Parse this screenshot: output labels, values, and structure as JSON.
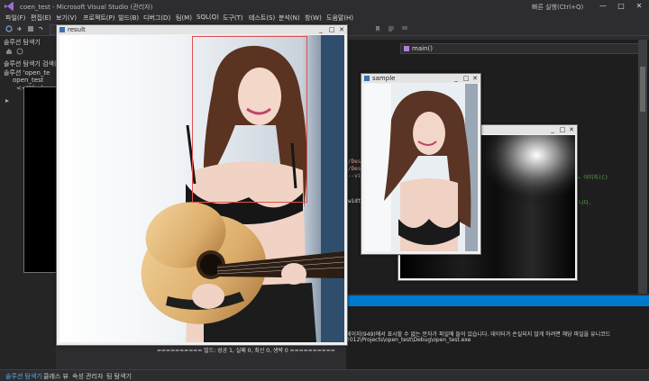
{
  "window": {
    "title": "coen_test - Microsoft Visual Studio (관리자)",
    "quick_launch": "빠른 실행(Ctrl+Q)",
    "minimize": "—",
    "maximize": "□",
    "close": "✕"
  },
  "menu": [
    "파일(F)",
    "편집(E)",
    "보기(V)",
    "프로젝트(P)",
    "빌드(B)",
    "디버그(D)",
    "팀(M)",
    "SQL(Q)",
    "도구(T)",
    "테스트(S)",
    "분석(N)",
    "창(W)",
    "도움말(H)"
  ],
  "solution_explorer": {
    "title": "솔루션 탐색기",
    "search_placeholder": "솔루션 탐색기 검색(",
    "items": [
      "솔루션 'open_te",
      "open_test",
      "<<Wind"
    ]
  },
  "editor": {
    "function_combo": "main()",
    "code_lines": [
      "/Desk",
      "/Desk",
      "--vide",
      "→ 이미지(C)",
      "width",
      "니다.",
      "니다."
    ]
  },
  "output": {
    "lines": [
      "페이지(949)에서 표시할 수 없는 문자가 파일에 들어 있습니다. 데이터가 손실되지 않게 하려면 해당 파일을 유니코드",
      "2012\\Projects\\open_test\\Debug\\open_test.exe"
    ],
    "build_summary": "========== 빌드: 성공 1, 실패 0, 최신 0, 생략 0 =========="
  },
  "status_bar": {
    "items": [
      "솔루션 탐색기",
      "클래스 뷰",
      "속성 관리자",
      "팀 탐색기"
    ]
  },
  "cv_windows": {
    "result_title": "result",
    "sample_title": "sample",
    "third_title": ""
  },
  "colors": {
    "vs_bg": "#2d2d30",
    "editor_bg": "#1e1e1e",
    "accent": "#007acc",
    "detect_rect": "#e05050"
  }
}
